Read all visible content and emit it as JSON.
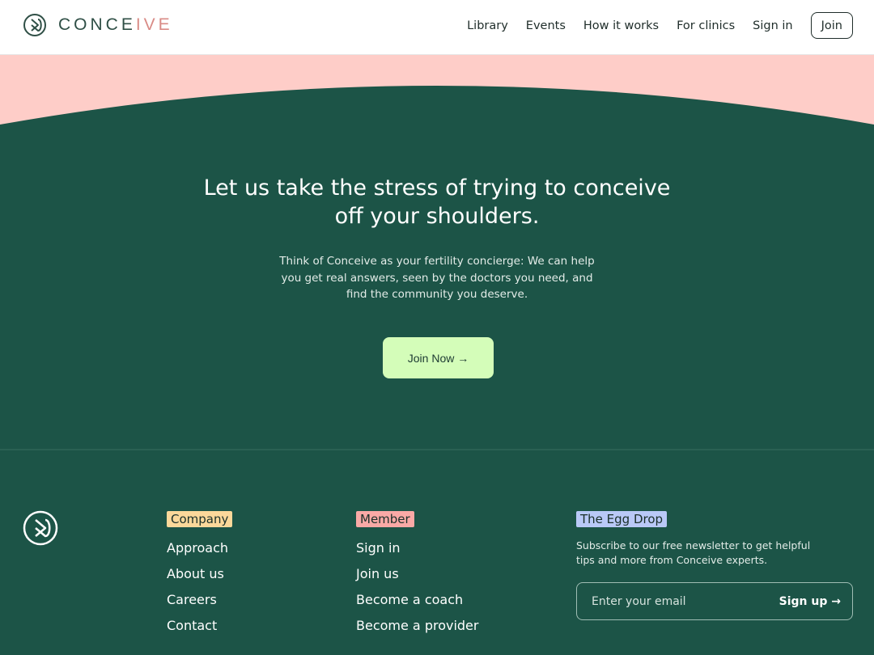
{
  "brand": {
    "name_main": "CONCE",
    "name_accent": "IVE"
  },
  "nav": {
    "items": [
      {
        "label": "Library"
      },
      {
        "label": "Events"
      },
      {
        "label": "How it works"
      },
      {
        "label": "For clinics"
      },
      {
        "label": "Sign in"
      }
    ],
    "join_label": "Join"
  },
  "hero": {
    "title": "Let us take the stress of trying to conceive off your shoulders.",
    "subtitle": "Think of Conceive as your fertility concierge: We can help you get real answers, seen by the doctors you need, and find the community you deserve.",
    "cta_label": "Join Now →"
  },
  "footer": {
    "company": {
      "heading": "Company",
      "links": [
        "Approach",
        "About us",
        "Careers",
        "Contact"
      ]
    },
    "member": {
      "heading": "Member",
      "links": [
        "Sign in",
        "Join us",
        "Become a coach",
        "Become a provider"
      ]
    },
    "newsletter": {
      "heading": "The Egg Drop",
      "text": "Subscribe to our free newsletter to get helpful tips and more from Conceive experts.",
      "email_placeholder": "Enter your email",
      "signup_label": "Sign up →"
    }
  },
  "colors": {
    "green": "#1c5447",
    "pink": "#fecdc8",
    "cta": "#d4fdb9",
    "highlight_yellow": "#fbd89a",
    "highlight_pink": "#f9a9a6",
    "highlight_blue": "#b9c9f7"
  }
}
